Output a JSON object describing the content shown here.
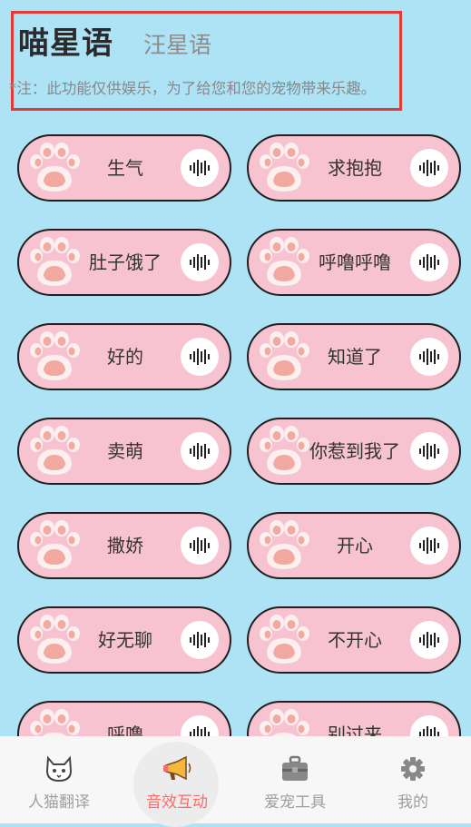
{
  "header": {
    "tab_cat": "喵星语",
    "tab_dog": "汪星语",
    "note": "*注：此功能仅供娱乐，为了给您和您的宠物带来乐趣。"
  },
  "sounds": [
    {
      "label": "生气"
    },
    {
      "label": "求抱抱"
    },
    {
      "label": "肚子饿了"
    },
    {
      "label": "呼噜呼噜"
    },
    {
      "label": "好的"
    },
    {
      "label": "知道了"
    },
    {
      "label": "卖萌"
    },
    {
      "label": "你惹到我了"
    },
    {
      "label": "撒娇"
    },
    {
      "label": "开心"
    },
    {
      "label": "好无聊"
    },
    {
      "label": "不开心"
    },
    {
      "label": "呼噜"
    },
    {
      "label": "别过来"
    }
  ],
  "nav": [
    {
      "label": "人猫翻译",
      "icon": "cat-face-icon"
    },
    {
      "label": "音效互动",
      "icon": "megaphone-icon"
    },
    {
      "label": "爱宠工具",
      "icon": "toolbox-icon"
    },
    {
      "label": "我的",
      "icon": "gear-icon"
    }
  ],
  "colors": {
    "background": "#aee3f5",
    "card": "#f7c3d0",
    "active_nav": "#ff6b6b",
    "highlight_box": "#e53935"
  }
}
